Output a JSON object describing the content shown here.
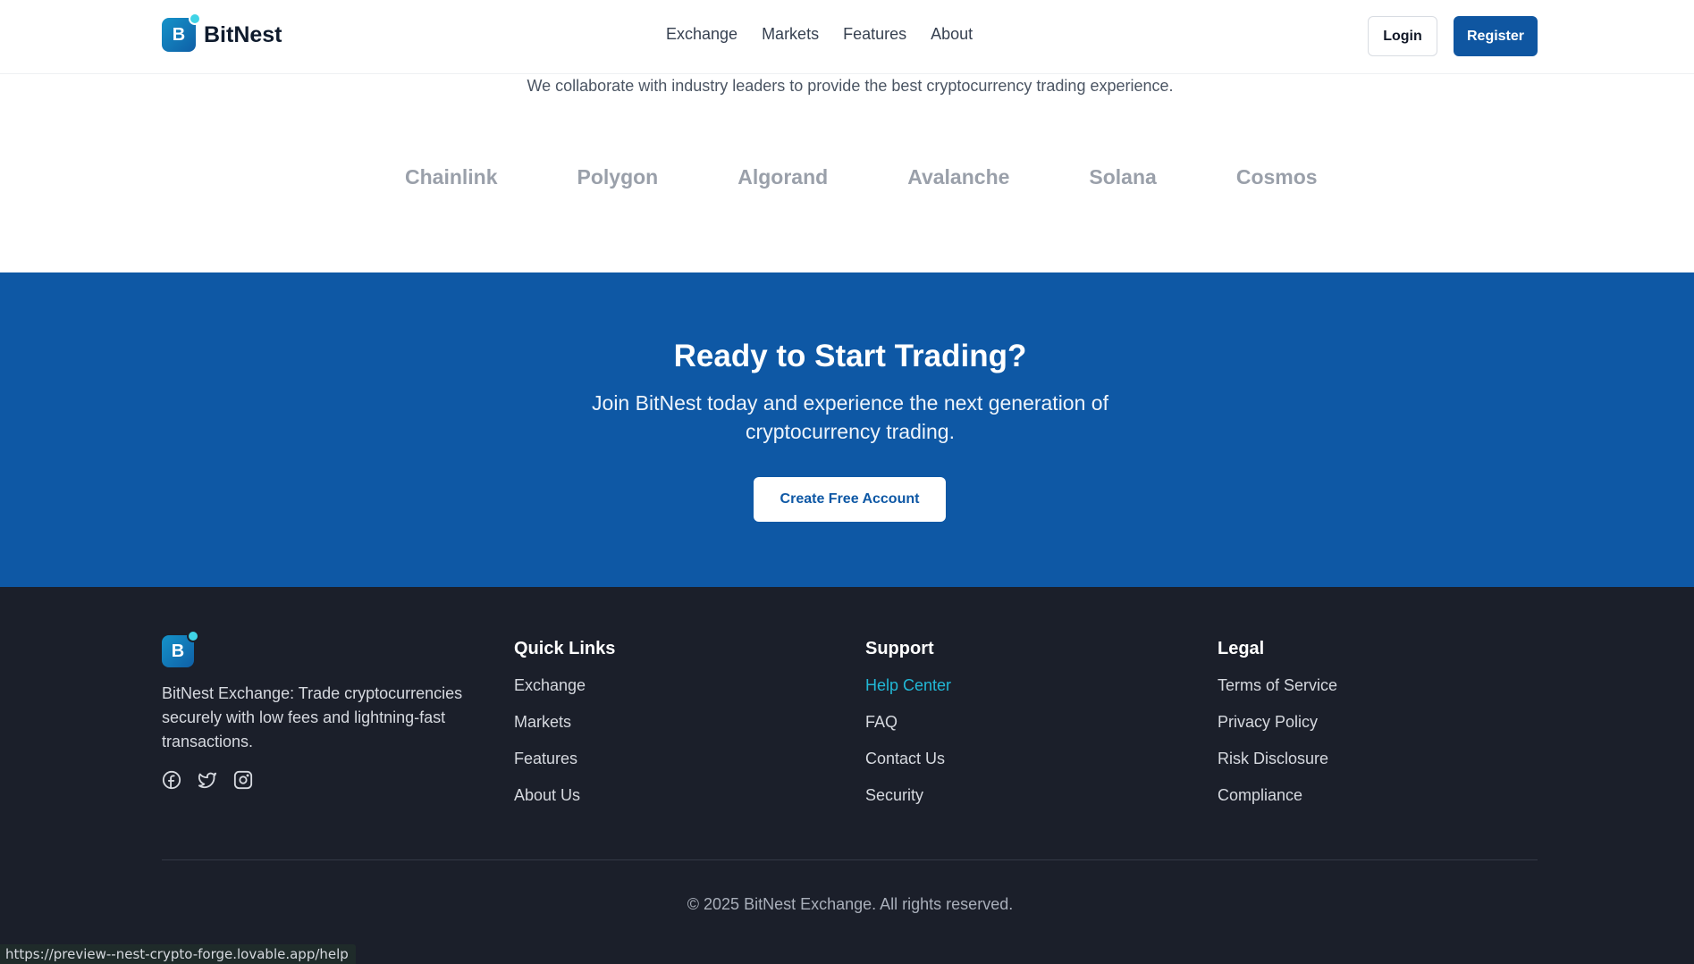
{
  "header": {
    "brand_letter": "B",
    "brand_name": "BitNest",
    "nav": [
      "Exchange",
      "Markets",
      "Features",
      "About"
    ],
    "login_label": "Login",
    "register_label": "Register"
  },
  "partners": {
    "subtitle": "We collaborate with industry leaders to provide the best cryptocurrency trading experience.",
    "names": [
      "Chainlink",
      "Polygon",
      "Algorand",
      "Avalanche",
      "Solana",
      "Cosmos"
    ]
  },
  "cta": {
    "title": "Ready to Start Trading?",
    "subtitle": "Join BitNest today and experience the next generation of cryptocurrency trading.",
    "button_label": "Create Free Account"
  },
  "footer": {
    "brand_letter": "B",
    "description": "BitNest Exchange: Trade cryptocurrencies securely with low fees and lightning-fast transactions.",
    "socials": [
      "facebook-icon",
      "twitter-icon",
      "instagram-icon"
    ],
    "quick_links": {
      "title": "Quick Links",
      "items": [
        "Exchange",
        "Markets",
        "Features",
        "About Us"
      ]
    },
    "support": {
      "title": "Support",
      "items": [
        "Help Center",
        "FAQ",
        "Contact Us",
        "Security"
      ]
    },
    "legal": {
      "title": "Legal",
      "items": [
        "Terms of Service",
        "Privacy Policy",
        "Risk Disclosure",
        "Compliance"
      ]
    },
    "copyright": "© 2025 BitNest Exchange. All rights reserved."
  },
  "status_bar": {
    "url": "https://preview--nest-crypto-forge.lovable.app/help"
  },
  "colors": {
    "primary": "#0e58a5",
    "footer_bg": "#1b1f2a",
    "link_active": "#22b8d6",
    "partner_text": "#9aa0aa"
  }
}
